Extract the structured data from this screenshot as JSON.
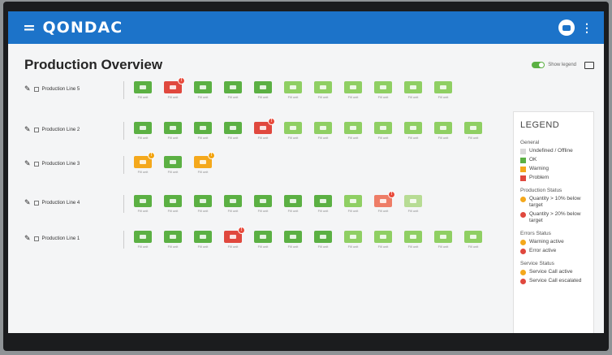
{
  "app": {
    "brand": "= QONDAC"
  },
  "page": {
    "title": "Production Overview",
    "show_legend_label": "Show legend"
  },
  "lines": [
    {
      "label": "Production Line 5",
      "machines": [
        {
          "status": "ok",
          "label": "Fill unit"
        },
        {
          "status": "problem",
          "badge": "error",
          "label": "Fill unit"
        },
        {
          "status": "ok",
          "label": "Fill unit"
        },
        {
          "status": "ok",
          "label": "Fill unit"
        },
        {
          "status": "ok",
          "label": "Fill unit"
        },
        {
          "status": "ok-light",
          "label": "Fill unit"
        },
        {
          "status": "ok-light",
          "label": "Fill unit"
        },
        {
          "status": "ok-light",
          "label": "Fill unit"
        },
        {
          "status": "ok-light",
          "label": "Fill unit"
        },
        {
          "status": "ok-light",
          "label": "Fill unit"
        },
        {
          "status": "ok-light",
          "label": "Fill unit"
        }
      ]
    },
    {
      "label": "Production Line 2",
      "machines": [
        {
          "status": "ok",
          "label": "Fill unit"
        },
        {
          "status": "ok",
          "label": "Fill unit"
        },
        {
          "status": "ok",
          "label": "Fill unit"
        },
        {
          "status": "ok",
          "label": "Fill unit"
        },
        {
          "status": "problem",
          "badge": "error",
          "label": "Fill unit"
        },
        {
          "status": "ok-light",
          "label": "Fill unit"
        },
        {
          "status": "ok-light",
          "label": "Fill unit"
        },
        {
          "status": "ok-light",
          "label": "Fill unit"
        },
        {
          "status": "ok-light",
          "label": "Fill unit"
        },
        {
          "status": "ok-light",
          "label": "Fill unit"
        },
        {
          "status": "ok-light",
          "label": "Fill unit"
        },
        {
          "status": "ok-light",
          "label": "Fill unit"
        }
      ]
    },
    {
      "label": "Production Line 3",
      "machines": [
        {
          "status": "warning",
          "badge": "warning",
          "label": "Fill unit"
        },
        {
          "status": "ok",
          "label": "Fill unit"
        },
        {
          "status": "warning",
          "badge": "warning",
          "label": "Fill unit"
        }
      ]
    },
    {
      "label": "Production Line 4",
      "machines": [
        {
          "status": "ok",
          "label": "Fill unit"
        },
        {
          "status": "ok",
          "label": "Fill unit"
        },
        {
          "status": "ok",
          "label": "Fill unit"
        },
        {
          "status": "ok",
          "label": "Fill unit"
        },
        {
          "status": "ok",
          "label": "Fill unit"
        },
        {
          "status": "ok",
          "label": "Fill unit"
        },
        {
          "status": "ok",
          "label": "Fill unit"
        },
        {
          "status": "ok-light",
          "label": "Fill unit"
        },
        {
          "status": "problem-light",
          "badge": "error",
          "label": "Fill unit"
        },
        {
          "status": "ok-pale",
          "label": "Fill unit"
        }
      ]
    },
    {
      "label": "Production Line 1",
      "machines": [
        {
          "status": "ok",
          "label": "Fill unit"
        },
        {
          "status": "ok",
          "label": "Fill unit"
        },
        {
          "status": "ok",
          "label": "Fill unit"
        },
        {
          "status": "problem",
          "badge": "error",
          "label": "Fill unit"
        },
        {
          "status": "ok",
          "label": "Fill unit"
        },
        {
          "status": "ok",
          "label": "Fill unit"
        },
        {
          "status": "ok",
          "label": "Fill unit"
        },
        {
          "status": "ok-light",
          "label": "Fill unit"
        },
        {
          "status": "ok-light",
          "label": "Fill unit"
        },
        {
          "status": "ok-light",
          "label": "Fill unit"
        },
        {
          "status": "ok-light",
          "label": "Fill unit"
        },
        {
          "status": "ok-light",
          "label": "Fill unit"
        }
      ]
    }
  ],
  "legend": {
    "title": "LEGEND",
    "general_title": "General",
    "undefined_label": "Undefined / Offline",
    "ok_label": "OK",
    "warning_label": "Warning",
    "problem_label": "Problem",
    "production_title": "Production Status",
    "prod_q10": "Quantity > 10% below target",
    "prod_q20": "Quantity > 20% below target",
    "errors_title": "Errors Status",
    "warning_active": "Warning active",
    "error_active": "Error active",
    "service_title": "Service Status",
    "service_active": "Service Call active",
    "service_escalated": "Service Call escalated"
  },
  "colors": {
    "brand": "#1c73c9",
    "ok": "#5bb043",
    "warning": "#f4a81c",
    "problem": "#e0483e",
    "undefined": "#d9d9d9"
  }
}
